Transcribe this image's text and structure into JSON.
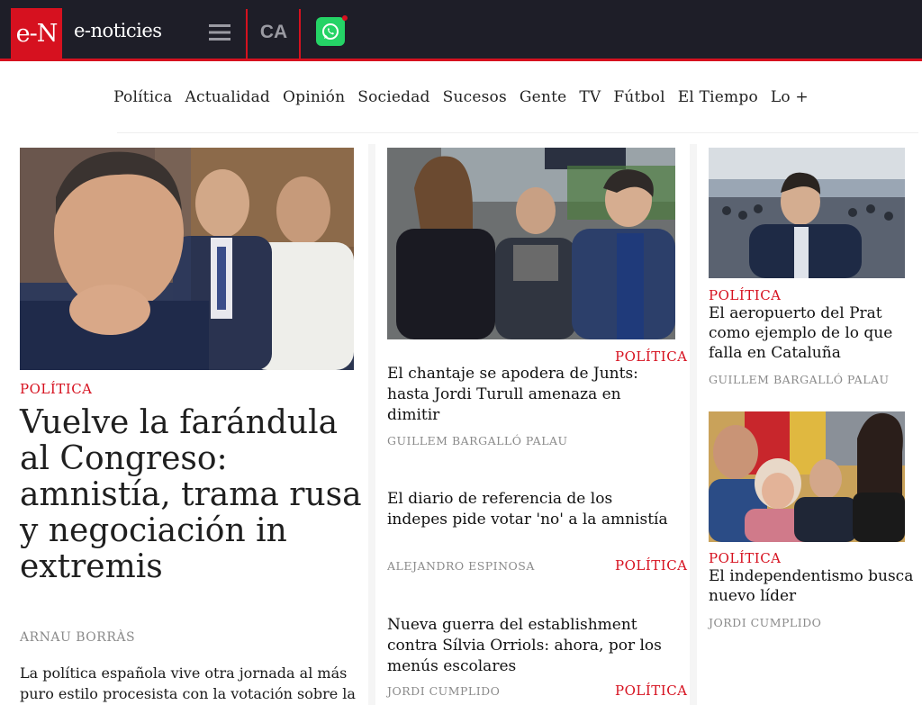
{
  "header": {
    "logo_text": "e-N",
    "site_name": "e-noticies",
    "site_name_display": "e-noticies",
    "menu_icon": "hamburger-menu-icon",
    "language": "CA",
    "whatsapp_icon": "whatsapp-icon"
  },
  "nav": {
    "items": [
      "Política",
      "Actualidad",
      "Opinión",
      "Sociedad",
      "Sucesos",
      "Gente",
      "TV",
      "Fútbol",
      "El Tiempo",
      "Lo +"
    ]
  },
  "lead": {
    "image_alt": "photo-pedro-sanchez-puigdemont-junqueras",
    "kicker": "POLÍTICA",
    "headline": "Vuelve la farándula al Congreso: amnistía, trama rusa y negociación in extremis",
    "author": "ARNAU BORRÀS",
    "summary": "La política española vive otra jornada al más puro estilo procesista con la votación sobre la"
  },
  "middle": [
    {
      "kicker": "POLÍTICA",
      "headline": "El chantaje se apodera de Junts: hasta Jordi Turull amenaza en dimitir",
      "author": "GUILLEM BARGALLÓ PALAU"
    },
    {
      "kicker": "POLÍTICA",
      "headline": "El diario de referencia de los indepes pide votar 'no' a la amnistía",
      "author": "ALEJANDRO ESPINOSA"
    },
    {
      "kicker": "POLÍTICA",
      "headline": "Nueva guerra del establishment contra Sílvia Orriols: ahora, por los menús escolares",
      "author": "JORDI CUMPLIDO"
    }
  ],
  "right": [
    {
      "kicker": "POLÍTICA",
      "headline": "El aeropuerto del Prat como ejemplo de lo que falla en Cataluña",
      "author": "GUILLEM BARGALLÓ PALAU"
    },
    {
      "kicker": "POLÍTICA",
      "headline": "El independentismo busca nuevo líder",
      "author": "JORDI CUMPLIDO"
    }
  ],
  "colors": {
    "brand_red": "#d6111f",
    "topbar_bg": "#1e1e28",
    "whatsapp_green": "#25d366"
  }
}
